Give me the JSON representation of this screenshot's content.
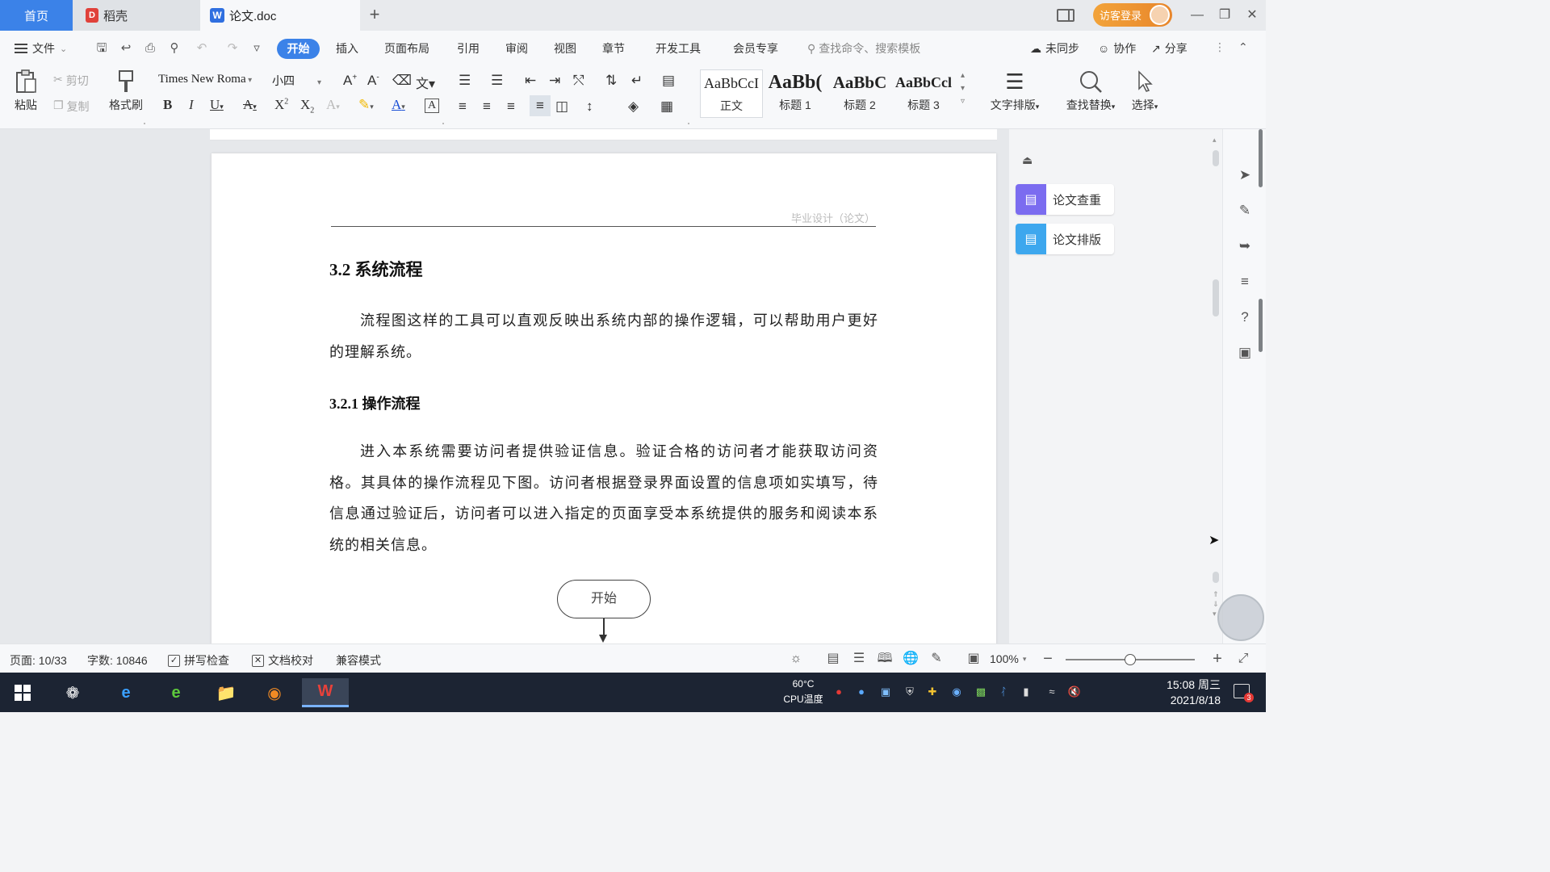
{
  "tabs": {
    "home": "首页",
    "daoke": "稻壳",
    "doc": "论文.doc",
    "add": "+"
  },
  "titlebar": {
    "visitor_login": "访客登录"
  },
  "menu": {
    "file": "文件",
    "start": "开始",
    "insert": "插入",
    "page_layout": "页面布局",
    "reference": "引用",
    "review": "审阅",
    "view": "视图",
    "chapter": "章节",
    "dev_tools": "开发工具",
    "member": "会员专享",
    "search_placeholder": "查找命令、搜索模板",
    "unsynced": "未同步",
    "collaborate": "协作",
    "share": "分享"
  },
  "ribbon": {
    "paste": "粘贴",
    "cut": "剪切",
    "copy": "复制",
    "format_painter": "格式刷",
    "font_name": "Times New Roma",
    "font_size": "小四",
    "styles": [
      {
        "preview": "AaBbCcI",
        "label": "正文"
      },
      {
        "preview": "AaBb(",
        "label": "标题 1"
      },
      {
        "preview": "AaBbC",
        "label": "标题 2"
      },
      {
        "preview": "AaBbCcl",
        "label": "标题 3"
      }
    ],
    "text_layout": "文字排版",
    "find_replace": "查找替换",
    "select": "选择"
  },
  "document": {
    "header_text": "毕业设计（论文）",
    "section_title": "3.2  系统流程",
    "para1": "流程图这样的工具可以直观反映出系统内部的操作逻辑，可以帮助用户更好的理解系统。",
    "subsection_title": "3.2.1  操作流程",
    "para2": "进入本系统需要访问者提供验证信息。验证合格的访问者才能获取访问资格。其具体的操作流程见下图。访问者根据登录界面设置的信息项如实填写，待信息通过验证后，访问者可以进入指定的页面享受本系统提供的服务和阅读本系统的相关信息。",
    "flow_start": "开始"
  },
  "side_panel": {
    "check": "论文查重",
    "format": "论文排版"
  },
  "status": {
    "page": "页面: 10/33",
    "words": "字数: 10846",
    "spell_check": "拼写检查",
    "doc_proof": "文档校对",
    "compat_mode": "兼容模式",
    "zoom": "100%",
    "zoom_fraction": 0.5
  },
  "taskbar": {
    "cpu_temp": "60°C",
    "cpu_label": "CPU温度",
    "time": "15:08 周三",
    "date": "2021/8/18",
    "notif_count": "3"
  },
  "colors": {
    "accent": "#3b82e8",
    "check_icon": "#7b6cf0",
    "format_icon": "#3da7ee"
  }
}
